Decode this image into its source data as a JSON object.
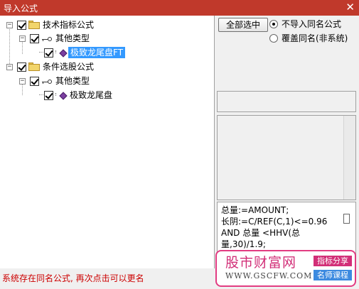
{
  "window": {
    "title": "导入公式",
    "close_glyph": "✕"
  },
  "tree": {
    "nodes": [
      {
        "label": "技术指标公式",
        "expander": "−",
        "icon": "folder-icon",
        "checked": true
      },
      {
        "label": "其他类型",
        "expander": "−",
        "icon": "key-icon",
        "checked": true
      },
      {
        "label": "极致龙尾盘FT",
        "icon": "formula-gem-icon",
        "checked": true,
        "selected": true
      },
      {
        "label": "条件选股公式",
        "expander": "−",
        "icon": "folder-icon",
        "checked": true
      },
      {
        "label": "其他类型",
        "expander": "−",
        "icon": "key-icon",
        "checked": true
      },
      {
        "label": "极致龙尾盘",
        "icon": "formula-gem-icon",
        "checked": true
      }
    ]
  },
  "options": {
    "select_all_label": "全部选中",
    "radio_no_import": "不导入同名公式",
    "radio_overwrite": "覆盖同名(非系统)",
    "selected": "no_import"
  },
  "code": {
    "lines": [
      "总量:=AMOUNT;",
      "长阴:=C/REF(C,1)<=0.96",
      "AND 总量 <HHV(总",
      "量,30)/1.9;"
    ]
  },
  "status": {
    "message": "系统存在同名公式, 再次点击可以更名"
  },
  "watermark": {
    "title": "股市财富网",
    "url": "WWW.GSCFW.COM",
    "tag1": "指标分享",
    "tag2": "名师课程"
  },
  "colors": {
    "titlebar": "#c0392b",
    "selection": "#3399ff",
    "status_text": "#cc0000",
    "watermark_accent": "#d22f78"
  }
}
